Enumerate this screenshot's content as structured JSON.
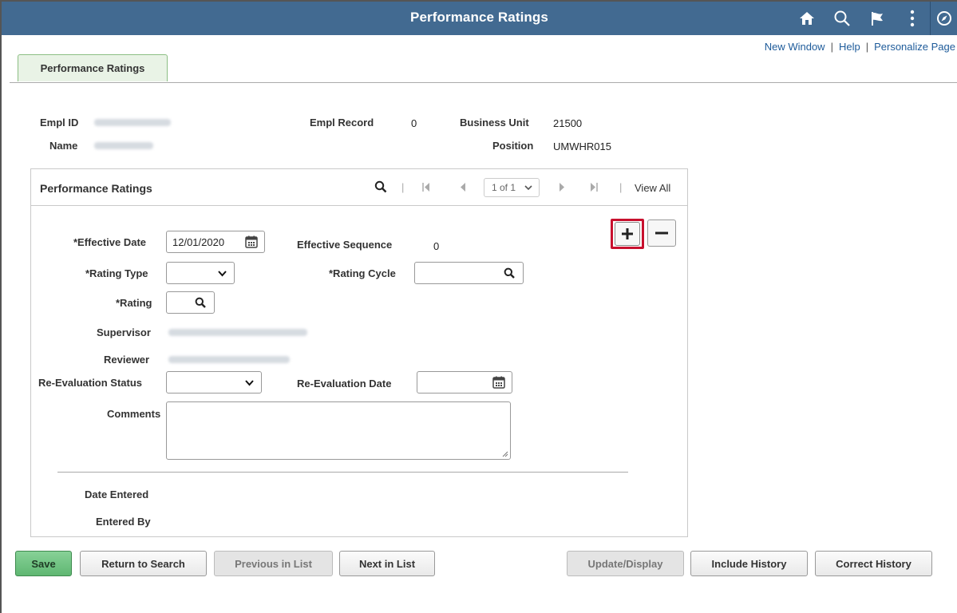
{
  "header": {
    "title": "Performance Ratings"
  },
  "top_links": {
    "new_window": "New Window",
    "help": "Help",
    "personalize": "Personalize Page",
    "separator": "|"
  },
  "tab": {
    "label": "Performance Ratings"
  },
  "employee": {
    "empl_id_label": "Empl ID",
    "name_label": "Name",
    "empl_record_label": "Empl Record",
    "empl_record_value": "0",
    "business_unit_label": "Business Unit",
    "business_unit_value": "21500",
    "position_label": "Position",
    "position_value": "UMWHR015"
  },
  "panel": {
    "title": "Performance Ratings",
    "nav_separator": "|",
    "pager_value": "1 of 1",
    "view_all": "View All"
  },
  "form": {
    "effective_date_label": "*Effective Date",
    "effective_date_value": "12/01/2020",
    "effective_sequence_label": "Effective Sequence",
    "effective_sequence_value": "0",
    "rating_type_label": "*Rating Type",
    "rating_cycle_label": "*Rating Cycle",
    "rating_label": "*Rating",
    "supervisor_label": "Supervisor",
    "reviewer_label": "Reviewer",
    "reeval_status_label": "Re-Evaluation Status",
    "reeval_date_label": "Re-Evaluation Date",
    "comments_label": "Comments",
    "date_entered_label": "Date Entered",
    "entered_by_label": "Entered By"
  },
  "buttons": {
    "save": "Save",
    "return_to_search": "Return to Search",
    "previous_in_list": "Previous in List",
    "next_in_list": "Next in List",
    "update_display": "Update/Display",
    "include_history": "Include History",
    "correct_history": "Correct History"
  },
  "colors": {
    "banner": "#426a91",
    "highlight": "#c8102e",
    "save_button": "#5fb772",
    "link": "#1e5b9a"
  },
  "icons": [
    "home-icon",
    "search-icon",
    "flag-icon",
    "kebab-menu-icon",
    "compass-icon",
    "calendar-icon",
    "magnifier-icon",
    "chevron-down-icon",
    "plus-icon",
    "minus-icon"
  ]
}
